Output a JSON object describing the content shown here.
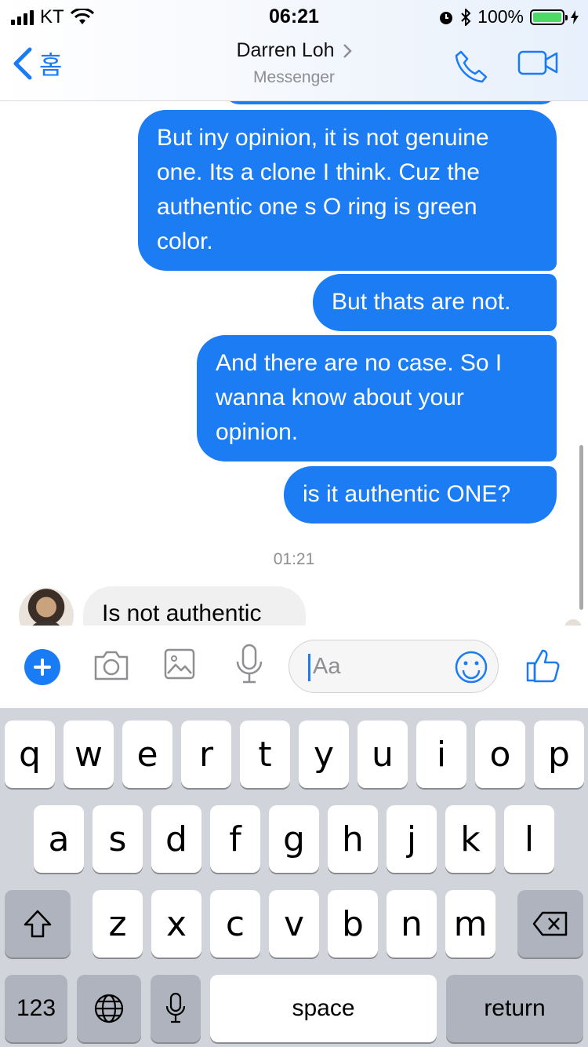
{
  "status": {
    "carrier": "KT",
    "time": "06:21",
    "battery": "100%"
  },
  "header": {
    "back_label": "홈",
    "contact_name": "Darren Loh",
    "app_name": "Messenger"
  },
  "messages": [
    {
      "side": "out",
      "text": "But iny opinion, it is not genuine one. Its a clone I think. Cuz the authentic one  s O ring is green color."
    },
    {
      "side": "out",
      "text": "But thats are not."
    },
    {
      "side": "out",
      "text": "And there are no case. So I wanna know about your opinion."
    },
    {
      "side": "out",
      "text": "is it authentic ONE?"
    },
    {
      "side": "in",
      "text": "Is not authentic"
    }
  ],
  "timestamp": "01:21",
  "composer": {
    "placeholder": "Aa"
  },
  "keyboard": {
    "row1": [
      "q",
      "w",
      "e",
      "r",
      "t",
      "y",
      "u",
      "i",
      "o",
      "p"
    ],
    "row2": [
      "a",
      "s",
      "d",
      "f",
      "g",
      "h",
      "j",
      "k",
      "l"
    ],
    "row3": [
      "z",
      "x",
      "c",
      "v",
      "b",
      "n",
      "m"
    ],
    "numbers_key": "123",
    "space_key": "space",
    "return_key": "return"
  },
  "colors": {
    "accent": "#1a7cf5",
    "outgoing_bubble": "#1b7cf3",
    "incoming_bubble": "#f1f0f0",
    "keyboard_bg": "#d1d4da"
  }
}
